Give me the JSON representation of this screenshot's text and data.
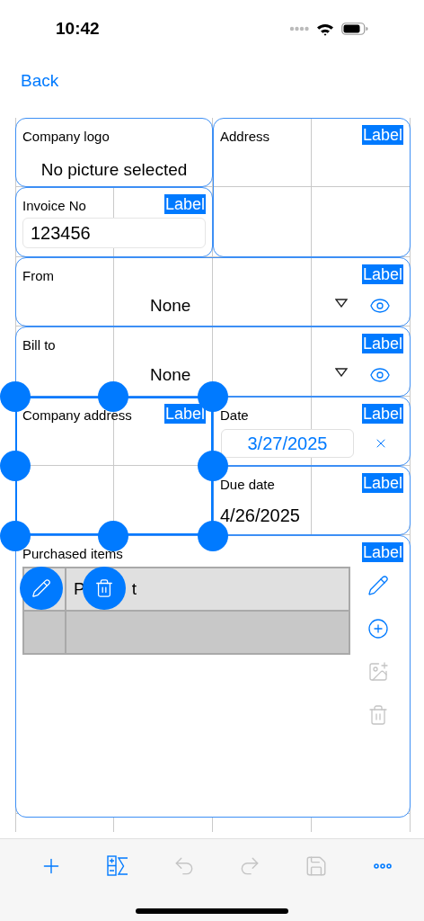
{
  "status_bar": {
    "time": "10:42"
  },
  "nav": {
    "back": "Back"
  },
  "widgets": [
    {
      "kind": "image",
      "title": "Company logo",
      "text": "No picture selected",
      "selected": false
    },
    {
      "kind": "text",
      "title": "Address",
      "badge": "Label",
      "selected": false
    },
    {
      "kind": "field",
      "title": "Invoice No",
      "badge": "Label",
      "value": "123456",
      "selected": false
    },
    {
      "kind": "picker",
      "title": "From",
      "badge": "Label",
      "value": "None",
      "selected": false
    },
    {
      "kind": "picker",
      "title": "Bill to",
      "badge": "Label",
      "value": "None",
      "selected": false
    },
    {
      "kind": "text",
      "title": "Company address",
      "badge": "Label",
      "selected": true
    },
    {
      "kind": "date",
      "title": "Date",
      "badge": "Label",
      "value": "3/27/2025",
      "selected": false
    },
    {
      "kind": "plain",
      "title": "Due date",
      "badge": "Label",
      "value": "4/26/2025",
      "selected": false
    },
    {
      "kind": "table",
      "title": "Purchased items",
      "badge": "Label",
      "header_parts": [
        "P",
        "t"
      ],
      "selected": false,
      "tools": [
        {
          "kind": "edit",
          "disabled": false
        },
        {
          "kind": "add",
          "disabled": false
        },
        {
          "kind": "photo",
          "disabled": true
        },
        {
          "kind": "delete",
          "disabled": true
        }
      ]
    }
  ],
  "toolbar": [
    {
      "kind": "add",
      "disabled": false
    },
    {
      "kind": "formula",
      "disabled": false
    },
    {
      "kind": "undo",
      "disabled": true
    },
    {
      "kind": "redo",
      "disabled": true
    },
    {
      "kind": "save",
      "disabled": true
    },
    {
      "kind": "more",
      "disabled": false
    }
  ]
}
